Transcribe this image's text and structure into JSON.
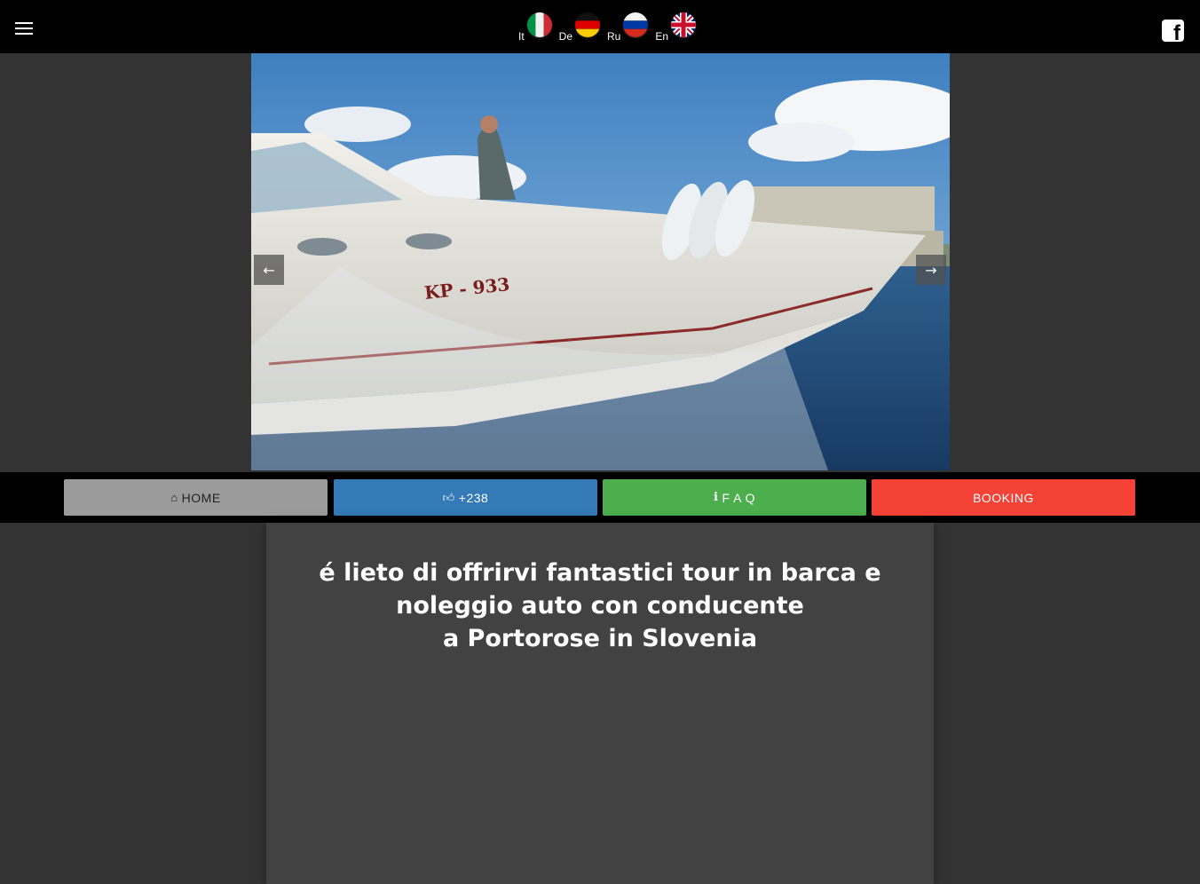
{
  "header": {
    "menu_icon": "hamburger-icon",
    "languages": [
      {
        "code": "It",
        "flag": "italy-flag-icon"
      },
      {
        "code": "De",
        "flag": "germany-flag-icon"
      },
      {
        "code": "Ru",
        "flag": "russia-flag-icon"
      },
      {
        "code": "En",
        "flag": "uk-flag-icon"
      }
    ],
    "social_icon": "facebook-icon",
    "social_glyph": "f"
  },
  "slider": {
    "image": "speedboat-photo",
    "boat_registration": "KP - 933",
    "prev_icon": "arrow-left-icon",
    "next_icon": "arrow-right-icon"
  },
  "nav_buttons": {
    "home": {
      "label": "HOME",
      "icon": "home-icon",
      "color": "#9b9b9b"
    },
    "like": {
      "label": "+238",
      "icon": "thumbs-up-icon",
      "color": "#337ab7"
    },
    "faq": {
      "label": "F A Q",
      "icon": "info-icon",
      "color": "#4cae4c"
    },
    "booking": {
      "label": "BOOKING",
      "color": "#f44336"
    }
  },
  "main": {
    "headline_lines": [
      "é lieto di offrirvi fantastici tour in barca e",
      "noleggio auto con conducente",
      "a Portorose in Slovenia"
    ]
  },
  "colors": {
    "page_background": "#333333",
    "content_background": "#424242",
    "bar_background": "#000000"
  }
}
